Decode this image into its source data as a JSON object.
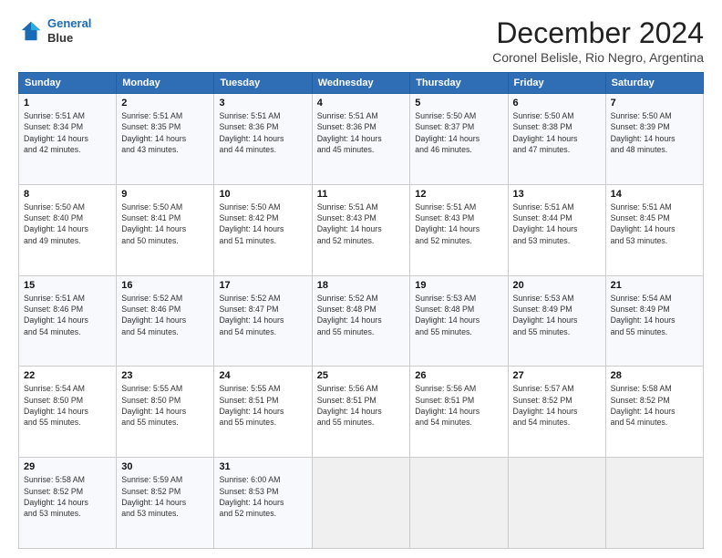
{
  "header": {
    "logo_line1": "General",
    "logo_line2": "Blue",
    "month_title": "December 2024",
    "location": "Coronel Belisle, Rio Negro, Argentina"
  },
  "weekdays": [
    "Sunday",
    "Monday",
    "Tuesday",
    "Wednesday",
    "Thursday",
    "Friday",
    "Saturday"
  ],
  "weeks": [
    [
      {
        "day": "1",
        "info": "Sunrise: 5:51 AM\nSunset: 8:34 PM\nDaylight: 14 hours\nand 42 minutes."
      },
      {
        "day": "2",
        "info": "Sunrise: 5:51 AM\nSunset: 8:35 PM\nDaylight: 14 hours\nand 43 minutes."
      },
      {
        "day": "3",
        "info": "Sunrise: 5:51 AM\nSunset: 8:36 PM\nDaylight: 14 hours\nand 44 minutes."
      },
      {
        "day": "4",
        "info": "Sunrise: 5:51 AM\nSunset: 8:36 PM\nDaylight: 14 hours\nand 45 minutes."
      },
      {
        "day": "5",
        "info": "Sunrise: 5:50 AM\nSunset: 8:37 PM\nDaylight: 14 hours\nand 46 minutes."
      },
      {
        "day": "6",
        "info": "Sunrise: 5:50 AM\nSunset: 8:38 PM\nDaylight: 14 hours\nand 47 minutes."
      },
      {
        "day": "7",
        "info": "Sunrise: 5:50 AM\nSunset: 8:39 PM\nDaylight: 14 hours\nand 48 minutes."
      }
    ],
    [
      {
        "day": "8",
        "info": "Sunrise: 5:50 AM\nSunset: 8:40 PM\nDaylight: 14 hours\nand 49 minutes."
      },
      {
        "day": "9",
        "info": "Sunrise: 5:50 AM\nSunset: 8:41 PM\nDaylight: 14 hours\nand 50 minutes."
      },
      {
        "day": "10",
        "info": "Sunrise: 5:50 AM\nSunset: 8:42 PM\nDaylight: 14 hours\nand 51 minutes."
      },
      {
        "day": "11",
        "info": "Sunrise: 5:51 AM\nSunset: 8:43 PM\nDaylight: 14 hours\nand 52 minutes."
      },
      {
        "day": "12",
        "info": "Sunrise: 5:51 AM\nSunset: 8:43 PM\nDaylight: 14 hours\nand 52 minutes."
      },
      {
        "day": "13",
        "info": "Sunrise: 5:51 AM\nSunset: 8:44 PM\nDaylight: 14 hours\nand 53 minutes."
      },
      {
        "day": "14",
        "info": "Sunrise: 5:51 AM\nSunset: 8:45 PM\nDaylight: 14 hours\nand 53 minutes."
      }
    ],
    [
      {
        "day": "15",
        "info": "Sunrise: 5:51 AM\nSunset: 8:46 PM\nDaylight: 14 hours\nand 54 minutes."
      },
      {
        "day": "16",
        "info": "Sunrise: 5:52 AM\nSunset: 8:46 PM\nDaylight: 14 hours\nand 54 minutes."
      },
      {
        "day": "17",
        "info": "Sunrise: 5:52 AM\nSunset: 8:47 PM\nDaylight: 14 hours\nand 54 minutes."
      },
      {
        "day": "18",
        "info": "Sunrise: 5:52 AM\nSunset: 8:48 PM\nDaylight: 14 hours\nand 55 minutes."
      },
      {
        "day": "19",
        "info": "Sunrise: 5:53 AM\nSunset: 8:48 PM\nDaylight: 14 hours\nand 55 minutes."
      },
      {
        "day": "20",
        "info": "Sunrise: 5:53 AM\nSunset: 8:49 PM\nDaylight: 14 hours\nand 55 minutes."
      },
      {
        "day": "21",
        "info": "Sunrise: 5:54 AM\nSunset: 8:49 PM\nDaylight: 14 hours\nand 55 minutes."
      }
    ],
    [
      {
        "day": "22",
        "info": "Sunrise: 5:54 AM\nSunset: 8:50 PM\nDaylight: 14 hours\nand 55 minutes."
      },
      {
        "day": "23",
        "info": "Sunrise: 5:55 AM\nSunset: 8:50 PM\nDaylight: 14 hours\nand 55 minutes."
      },
      {
        "day": "24",
        "info": "Sunrise: 5:55 AM\nSunset: 8:51 PM\nDaylight: 14 hours\nand 55 minutes."
      },
      {
        "day": "25",
        "info": "Sunrise: 5:56 AM\nSunset: 8:51 PM\nDaylight: 14 hours\nand 55 minutes."
      },
      {
        "day": "26",
        "info": "Sunrise: 5:56 AM\nSunset: 8:51 PM\nDaylight: 14 hours\nand 54 minutes."
      },
      {
        "day": "27",
        "info": "Sunrise: 5:57 AM\nSunset: 8:52 PM\nDaylight: 14 hours\nand 54 minutes."
      },
      {
        "day": "28",
        "info": "Sunrise: 5:58 AM\nSunset: 8:52 PM\nDaylight: 14 hours\nand 54 minutes."
      }
    ],
    [
      {
        "day": "29",
        "info": "Sunrise: 5:58 AM\nSunset: 8:52 PM\nDaylight: 14 hours\nand 53 minutes."
      },
      {
        "day": "30",
        "info": "Sunrise: 5:59 AM\nSunset: 8:52 PM\nDaylight: 14 hours\nand 53 minutes."
      },
      {
        "day": "31",
        "info": "Sunrise: 6:00 AM\nSunset: 8:53 PM\nDaylight: 14 hours\nand 52 minutes."
      },
      {
        "day": "",
        "info": ""
      },
      {
        "day": "",
        "info": ""
      },
      {
        "day": "",
        "info": ""
      },
      {
        "day": "",
        "info": ""
      }
    ]
  ]
}
